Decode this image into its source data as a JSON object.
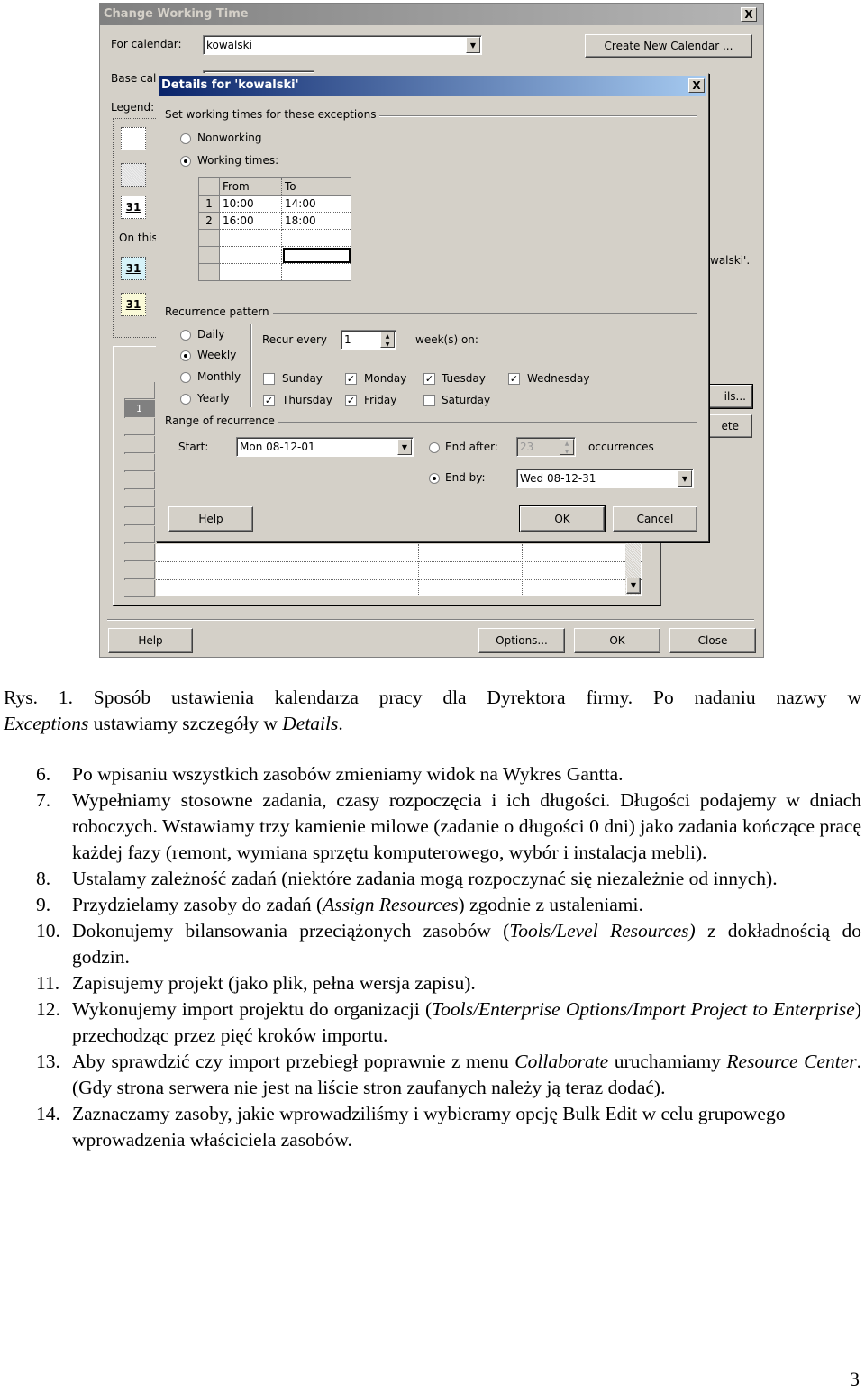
{
  "screenshot": {
    "outer_dialog": {
      "title": "Change Working Time",
      "close_glyph": "X",
      "for_calendar_label": "For calendar:",
      "for_calendar_value": "kowalski",
      "create_new_calendar_button": "Create New Calendar ...",
      "base_calendar_label": "Base cal",
      "legend_label": "Legend:",
      "legend_day_number": "31",
      "on_this_label": "On this",
      "right_text_fragment": "walski'.",
      "details_button_fragment": "ils...",
      "delete_button_fragment": "ete",
      "exceptions_row_number": "1",
      "help_button": "Help",
      "options_button": "Options...",
      "ok_button": "OK",
      "close_button": "Close"
    },
    "details_dialog": {
      "title": "Details for 'kowalski'",
      "close_glyph": "X",
      "exceptions_group_title": "Set working times for these exceptions",
      "mode_options": [
        {
          "label": "Nonworking",
          "selected": false
        },
        {
          "label": "Working times:",
          "selected": true
        }
      ],
      "working_times": {
        "headers": [
          "From",
          "To"
        ],
        "rows": [
          {
            "n": "1",
            "from": "10:00",
            "to": "14:00"
          },
          {
            "n": "2",
            "from": "16:00",
            "to": "18:00"
          },
          {
            "n": "",
            "from": "",
            "to": ""
          },
          {
            "n": "",
            "from": "",
            "to": ""
          },
          {
            "n": "",
            "from": "",
            "to": ""
          }
        ]
      },
      "recurrence_group_title": "Recurrence pattern",
      "recurrence_options": [
        {
          "label": "Daily",
          "selected": false
        },
        {
          "label": "Weekly",
          "selected": true
        },
        {
          "label": "Monthly",
          "selected": false
        },
        {
          "label": "Yearly",
          "selected": false
        }
      ],
      "recur_every_label": "Recur every",
      "recur_every_value": "1",
      "weeks_on_label": "week(s) on:",
      "days": [
        {
          "label": "Sunday",
          "checked": false
        },
        {
          "label": "Monday",
          "checked": true
        },
        {
          "label": "Tuesday",
          "checked": true
        },
        {
          "label": "Wednesday",
          "checked": true
        },
        {
          "label": "Thursday",
          "checked": true
        },
        {
          "label": "Friday",
          "checked": true
        },
        {
          "label": "Saturday",
          "checked": false
        }
      ],
      "range_group_title": "Range of recurrence",
      "start_label": "Start:",
      "start_value": "Mon 08-12-01",
      "end_after_label": "End after:",
      "end_after_value": "23",
      "end_after_selected": false,
      "occurrences_label": "occurrences",
      "end_by_label": "End by:",
      "end_by_value": "Wed 08-12-31",
      "end_by_selected": true,
      "help_button": "Help",
      "ok_button": "OK",
      "cancel_button": "Cancel"
    }
  },
  "document": {
    "caption_line1": "Rys. 1. Sposób ustawienia kalendarza pracy dla Dyrektora firmy. Po nadaniu nazwy w",
    "caption_line2_italic1": "Exceptions",
    "caption_line2_text": " ustawiamy szczegóły w ",
    "caption_line2_italic2": "Details",
    "caption_line2_end": ".",
    "steps": [
      {
        "num": "6.",
        "text": "Po wpisaniu wszystkich zasobów zmieniamy widok na Wykres Gantta."
      },
      {
        "num": "7.",
        "text": "Wypełniamy stosowne zadania, czasy rozpoczęcia i ich długości. Długości podajemy w dniach roboczych. Wstawiamy trzy kamienie milowe (zadanie o długości 0 dni) jako zadania kończące pracę każdej fazy (remont, wymiana sprzętu komputerowego, wybór i instalacja mebli)."
      },
      {
        "num": "8.",
        "text": "Ustalamy zależność zadań (niektóre zadania mogą rozpoczynać się niezależnie od innych)."
      },
      {
        "num": "9.",
        "pre": "Przydzielamy zasoby do zadań (",
        "italic": "Assign Resources",
        "post": ") zgodnie z ustaleniami."
      },
      {
        "num": "10.",
        "pre": "Dokonujemy bilansowania przeciążonych zasobów (",
        "italic": "Tools/Level Resources)",
        "post": " z dokładnością do godzin."
      },
      {
        "num": "11.",
        "text": "Zapisujemy projekt (jako plik, pełna wersja zapisu)."
      },
      {
        "num": "12.",
        "pre": "Wykonujemy import projektu do organizacji (",
        "italic": "Tools/Enterprise Options/Import Project to Enterprise",
        "post": ") przechodząc przez pięć kroków importu."
      },
      {
        "num": "13.",
        "pre": "Aby sprawdzić czy import przebiegł poprawnie z menu ",
        "italic": "Collaborate",
        "mid": " uruchamiamy ",
        "italic2": "Resource Center",
        "post": ". (Gdy strona serwera nie jest na liście stron zaufanych należy ją teraz dodać)."
      },
      {
        "num": "14.",
        "text": "Zaznaczamy zasoby, jakie wprowadziliśmy i wybieramy opcję Bulk Edit w celu grupowego wprowadzenia właściciela zasobów."
      }
    ],
    "page_number": "3"
  }
}
